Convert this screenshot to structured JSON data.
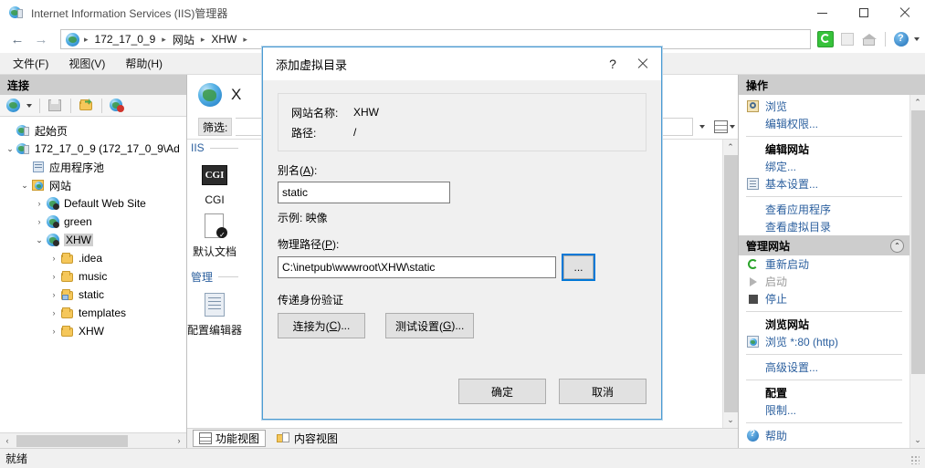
{
  "window": {
    "title": "Internet Information Services (IIS)管理器",
    "icon": "iis-server-icon",
    "minimize": "—",
    "maximize": "□",
    "close": "✕"
  },
  "address_bar": {
    "back": "←",
    "forward": "→",
    "crumb_icon": "globe-icon",
    "breadcrumbs": [
      "172_17_0_9",
      "网站",
      "XHW"
    ],
    "separator": "▸",
    "toolbar_icons": [
      "refresh-icon",
      "stop-icon",
      "home-icon",
      "help-icon"
    ],
    "help_caret": "▾"
  },
  "menubar": {
    "items": [
      {
        "label": "文件(F)"
      },
      {
        "label": "视图(V)"
      },
      {
        "label": "帮助(H)"
      }
    ]
  },
  "connections": {
    "header": "连接",
    "toolbar_icons": [
      "connect-globe-icon",
      "save-icon",
      "open-folder-icon",
      "disconnect-icon"
    ],
    "toolbar_caret": "▾",
    "tree": [
      {
        "label": "起始页",
        "indent": 1,
        "twisty": "",
        "icon": "start-page-icon",
        "selected": false
      },
      {
        "label": "172_17_0_9 (172_17_0_9\\Ad",
        "indent": 1,
        "twisty": "⌄",
        "icon": "server-icon",
        "selected": false
      },
      {
        "label": "应用程序池",
        "indent": 2,
        "twisty": "",
        "icon": "app-pools-icon",
        "selected": false
      },
      {
        "label": "网站",
        "indent": 2,
        "twisty": "⌄",
        "icon": "sites-icon",
        "selected": false
      },
      {
        "label": "Default Web Site",
        "indent": 3,
        "twisty": "›",
        "icon": "site-icon",
        "selected": false
      },
      {
        "label": "green",
        "indent": 3,
        "twisty": "›",
        "icon": "site-icon",
        "selected": false
      },
      {
        "label": "XHW",
        "indent": 3,
        "twisty": "⌄",
        "icon": "site-icon",
        "selected": true
      },
      {
        "label": ".idea",
        "indent": 4,
        "twisty": "›",
        "icon": "folder-icon",
        "selected": false
      },
      {
        "label": "music",
        "indent": 4,
        "twisty": "›",
        "icon": "folder-icon",
        "selected": false
      },
      {
        "label": "static",
        "indent": 4,
        "twisty": "›",
        "icon": "virtual-dir-icon",
        "selected": false
      },
      {
        "label": "templates",
        "indent": 4,
        "twisty": "›",
        "icon": "folder-icon",
        "selected": false
      },
      {
        "label": "XHW",
        "indent": 4,
        "twisty": "›",
        "icon": "folder-icon",
        "selected": false
      }
    ],
    "hscroll_left": "‹",
    "hscroll_right": "›"
  },
  "content": {
    "page_icon": "globe-icon",
    "page_title": "X",
    "filter_label": "筛选:",
    "filter_value": "",
    "view_caret": "▾",
    "view_icon": "grouping-icon",
    "view_caret2": "▾",
    "groups": [
      {
        "name": "IIS",
        "chevron": "⌃"
      },
      {
        "name": "管理",
        "chevron": "⌃"
      }
    ],
    "features": [
      {
        "label": "CGI",
        "icon": "cgi-icon",
        "group": "IIS"
      },
      {
        "label": "默认文档",
        "icon": "default-doc-icon",
        "group": "IIS"
      },
      {
        "label": "配置编辑器",
        "icon": "config-editor-icon",
        "group": "管理"
      }
    ],
    "scroll_up": "⌃",
    "scroll_down": "⌄",
    "tabs": [
      {
        "label": "功能视图",
        "icon": "feature-view-icon",
        "active": true
      },
      {
        "label": "内容视图",
        "icon": "content-view-icon",
        "active": false
      }
    ]
  },
  "actions": {
    "header": "操作",
    "scroll_up": "⌃",
    "scroll_down": "⌄",
    "items": [
      {
        "label": "浏览",
        "icon": "browse-icon",
        "style": "link",
        "type": "item"
      },
      {
        "label": "编辑权限...",
        "icon": "",
        "style": "link",
        "type": "item"
      },
      {
        "type": "separator"
      },
      {
        "label": "编辑网站",
        "icon": "",
        "style": "heading",
        "type": "item"
      },
      {
        "label": "绑定...",
        "icon": "",
        "style": "link",
        "type": "item"
      },
      {
        "label": "基本设置...",
        "icon": "settings-icon",
        "style": "link",
        "type": "item"
      },
      {
        "type": "separator"
      },
      {
        "label": "查看应用程序",
        "icon": "",
        "style": "link",
        "type": "item"
      },
      {
        "label": "查看虚拟目录",
        "icon": "",
        "style": "link",
        "type": "item"
      },
      {
        "type": "section",
        "label": "管理网站",
        "collapse": "⌃"
      },
      {
        "label": "重新启动",
        "icon": "restart-icon",
        "style": "link",
        "type": "item"
      },
      {
        "label": "启动",
        "icon": "start-icon",
        "style": "disabled",
        "type": "item"
      },
      {
        "label": "停止",
        "icon": "stop-icon",
        "style": "link",
        "type": "item"
      },
      {
        "type": "separator"
      },
      {
        "label": "浏览网站",
        "icon": "",
        "style": "heading",
        "type": "item"
      },
      {
        "label": "浏览 *:80 (http)",
        "icon": "browse-site-icon",
        "style": "link",
        "type": "item"
      },
      {
        "type": "separator"
      },
      {
        "label": "高级设置...",
        "icon": "",
        "style": "link",
        "type": "item"
      },
      {
        "type": "separator"
      },
      {
        "label": "配置",
        "icon": "",
        "style": "heading",
        "type": "item"
      },
      {
        "label": "限制...",
        "icon": "",
        "style": "link",
        "type": "item"
      },
      {
        "type": "separator"
      },
      {
        "label": "帮助",
        "icon": "help-icon",
        "style": "link",
        "type": "item"
      }
    ]
  },
  "status": {
    "text": "就绪",
    "grip": "resize-grip-icon"
  },
  "dialog": {
    "title": "添加虚拟目录",
    "help": "?",
    "close": "✕",
    "site_name_label": "网站名称:",
    "site_name_value": "XHW",
    "path_label": "路径:",
    "path_value": "/",
    "alias_label_pre": "别名(",
    "alias_label_key": "A",
    "alias_label_post": "):",
    "alias_value": "static",
    "alias_placeholder": "",
    "example_hint": "示例: 映像",
    "physical_label_pre": "物理路径(",
    "physical_label_key": "P",
    "physical_label_post": "):",
    "physical_value": "C:\\inetpub\\wwwroot\\XHW\\static",
    "browse_button": "...",
    "auth_section": "传递身份验证",
    "connect_as_pre": "连接为(",
    "connect_as_key": "C",
    "connect_as_post": ")...",
    "test_settings_pre": "测试设置(",
    "test_settings_key": "G",
    "test_settings_post": ")...",
    "ok": "确定",
    "cancel": "取消"
  }
}
